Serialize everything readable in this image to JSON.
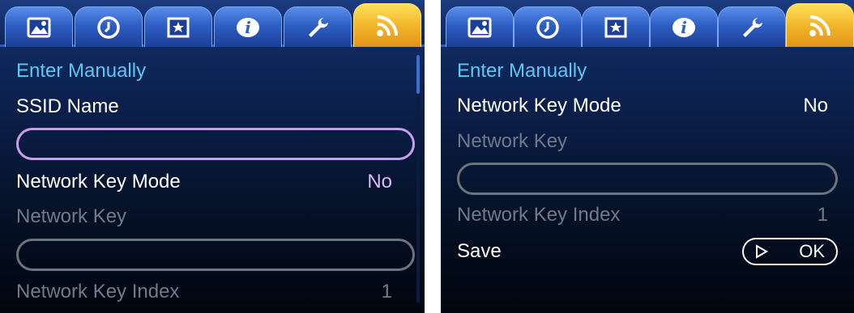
{
  "tabs": [
    {
      "icon": "photo-icon"
    },
    {
      "icon": "clock-icon"
    },
    {
      "icon": "slideshow-icon"
    },
    {
      "icon": "info-icon"
    },
    {
      "icon": "wrench-icon"
    },
    {
      "icon": "rss-icon",
      "active": true
    }
  ],
  "left": {
    "title": "Enter Manually",
    "ssid_label": "SSID Name",
    "ssid_value": "",
    "key_mode_label": "Network Key Mode",
    "key_mode_value": "No",
    "key_label": "Network Key",
    "key_value": "",
    "key_index_label": "Network Key Index",
    "key_index_value": "1"
  },
  "right": {
    "title": "Enter Manually",
    "key_mode_label": "Network Key Mode",
    "key_mode_value": "No",
    "key_label": "Network Key",
    "key_value": "",
    "key_index_label": "Network Key Index",
    "key_index_value": "1",
    "save_label": "Save",
    "ok_label": "OK"
  },
  "colors": {
    "section_title": "#59c8f5",
    "active_field_border": "#c99ee8",
    "disabled_text": "#6f7a8c",
    "active_tab": "#f3b52a",
    "tab": "#2e5fc4"
  }
}
